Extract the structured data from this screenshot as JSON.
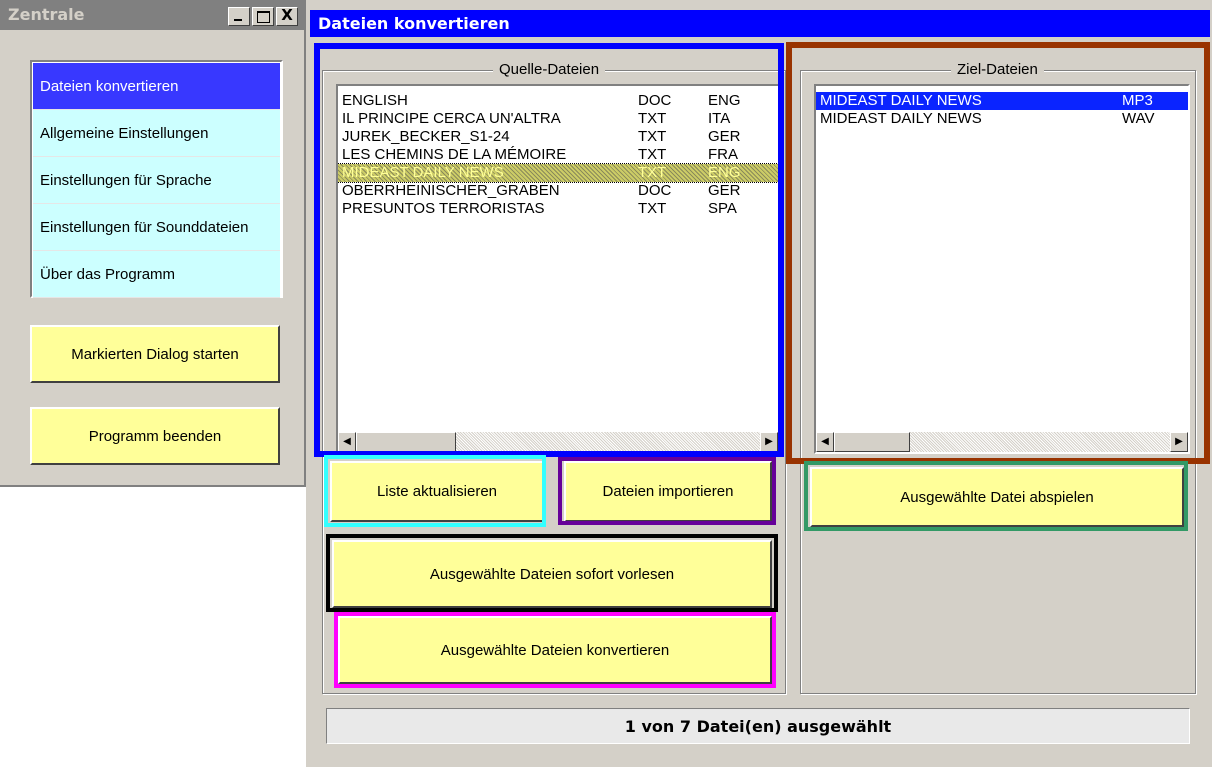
{
  "zentrale": {
    "title": "Zentrale",
    "window_controls": {
      "minimize": "",
      "maximize": "",
      "close": "X"
    },
    "nav_items": [
      {
        "label": "Dateien konvertieren",
        "active": true
      },
      {
        "label": "Allgemeine Einstellungen"
      },
      {
        "label": "Einstellungen für Sprache"
      },
      {
        "label": "Einstellungen für Sounddateien"
      },
      {
        "label": "Über das Programm"
      }
    ],
    "start_button": "Markierten Dialog starten",
    "exit_button": "Programm beenden"
  },
  "main": {
    "title": "Dateien konvertieren",
    "source": {
      "legend": "Quelle-Dateien",
      "files": [
        {
          "name": "ENGLISH",
          "type": "DOC",
          "lang": "ENG"
        },
        {
          "name": "IL PRINCIPE CERCA UN'ALTRA",
          "type": "TXT",
          "lang": "ITA"
        },
        {
          "name": "JUREK_BECKER_S1-24",
          "type": "TXT",
          "lang": "GER"
        },
        {
          "name": "LES CHEMINS DE LA MÉMOIRE",
          "type": "TXT",
          "lang": "FRA"
        },
        {
          "name": "MIDEAST DAILY NEWS",
          "type": "TXT",
          "lang": "ENG",
          "selected": true
        },
        {
          "name": "OBERRHEINISCHER_GRABEN",
          "type": "DOC",
          "lang": "GER"
        },
        {
          "name": "PRESUNTOS TERRORISTAS",
          "type": "TXT",
          "lang": "SPA"
        }
      ]
    },
    "target": {
      "legend": "Ziel-Dateien",
      "files": [
        {
          "name": "MIDEAST DAILY NEWS",
          "type": "MP3",
          "selected": true
        },
        {
          "name": "MIDEAST DAILY NEWS",
          "type": "WAV"
        }
      ]
    },
    "buttons": {
      "refresh": "Liste aktualisieren",
      "import": "Dateien importieren",
      "play": "Ausgewählte Datei abspielen",
      "read_aloud": "Ausgewählte Dateien sofort vorlesen",
      "convert": "Ausgewählte Dateien konvertieren"
    },
    "scroll_arrows": {
      "left": "◀",
      "right": "▶"
    },
    "status": "1 von 7 Datei(en) ausgewählt"
  },
  "colors": {
    "title_active": "#0000ff",
    "title_inactive": "#808080",
    "nav_bg": "#ccffff",
    "nav_active": "#3838ff",
    "button_bg": "#ffff99",
    "frame_blue": "#0000ff",
    "frame_brown": "#993300",
    "frame_cyan": "#33ffff",
    "frame_purple": "#660099",
    "frame_green": "#339966",
    "frame_black": "#000000",
    "frame_magenta": "#ff00ff"
  }
}
